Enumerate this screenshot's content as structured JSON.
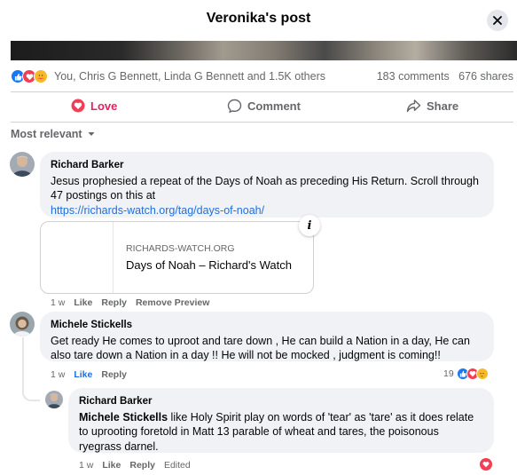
{
  "header": {
    "title": "Veronika's post"
  },
  "stats": {
    "reactions_text": "You, Chris G Bennett, Linda G Bennett and 1.5K others",
    "comments": "183 comments",
    "shares": "676 shares",
    "reaction_icons": [
      "like-icon",
      "love-icon",
      "care-icon"
    ]
  },
  "actions": {
    "love": "Love",
    "comment": "Comment",
    "share": "Share",
    "love_color": "#e0245e"
  },
  "sort": {
    "label": "Most relevant"
  },
  "comments": [
    {
      "author": "Richard Barker",
      "text": "Jesus prophesied a repeat of the Days of Noah as preceding His Return. Scroll through 47 postings on this at",
      "link": "https://richards-watch.org/tag/days-of-noah/",
      "preview": {
        "domain": "RICHARDS-WATCH.ORG",
        "title": "Days of Noah – Richard's Watch"
      },
      "meta": {
        "time": "1 w",
        "like": "Like",
        "reply": "Reply",
        "extra": "Remove Preview"
      }
    },
    {
      "author": "Michele Stickells",
      "text": "Get ready He comes to uproot and tare down , He can build a Nation in a day, He can also tare down a Nation in a day !! He will not be mocked , judgment is coming!!",
      "meta": {
        "time": "1 w",
        "like": "Like",
        "reply": "Reply"
      },
      "reaction_count": "19"
    },
    {
      "author": "Richard Barker",
      "mention": "Michele Stickells",
      "text": " like Holy Spirit play on words of 'tear' as 'tare' as it does relate to uprooting foretold in Matt 13 parable of wheat and tares, the poisonous ryegrass darnel.",
      "meta": {
        "time": "1 w",
        "like": "Like",
        "reply": "Reply",
        "edited": "Edited"
      }
    }
  ],
  "colors": {
    "accent": "#216fdb",
    "muted": "#65676b",
    "bubble": "#f0f2f5",
    "like": "#1877f2",
    "love": "#f33e58",
    "care": "#f7b928"
  }
}
